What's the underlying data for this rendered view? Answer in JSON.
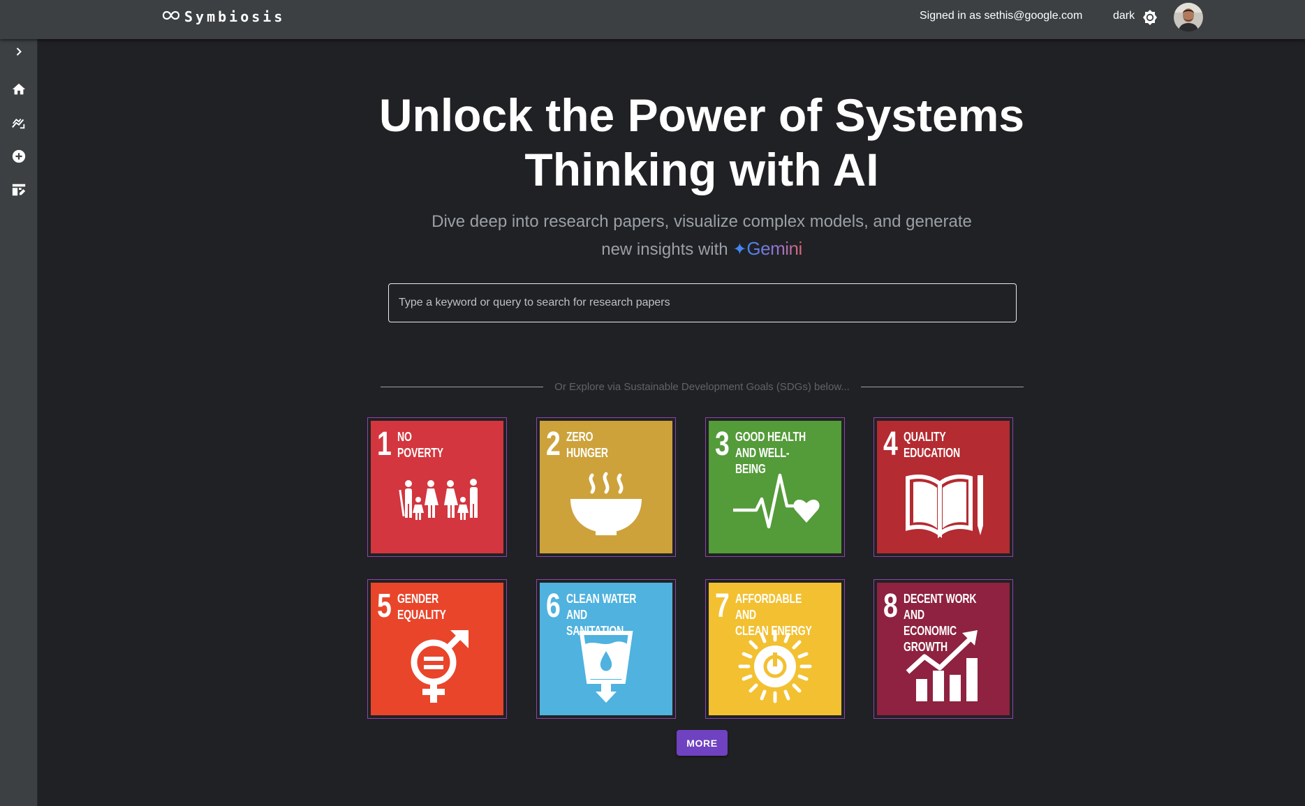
{
  "app": {
    "name": "Symbiosis"
  },
  "header": {
    "signed_in_text": "Signed in as sethis@google.com",
    "theme_label": "dark"
  },
  "sidebar": {
    "items": [
      {
        "icon": "chevron-right-icon"
      },
      {
        "icon": "home-icon"
      },
      {
        "icon": "analytics-icon"
      },
      {
        "icon": "add-circle-icon"
      },
      {
        "icon": "dashboard-edit-icon"
      }
    ]
  },
  "hero": {
    "title": "Unlock the Power of Systems Thinking with AI",
    "subtitle_prefix": "Dive deep into research papers, visualize complex models, and generate new insights with",
    "gemini_label": "Gemini"
  },
  "search": {
    "placeholder": "Type a keyword or query to search for research papers"
  },
  "divider_text": "Or Explore via Sustainable Development Goals (SDGs) below...",
  "sdgs": [
    {
      "number": "1",
      "title": "No\nPoverty",
      "color": "#d3363e",
      "icon": "family-icon"
    },
    {
      "number": "2",
      "title": "Zero\nHunger",
      "color": "#cda23b",
      "icon": "bowl-icon"
    },
    {
      "number": "3",
      "title": "Good Health\nand Well-Being",
      "color": "#549b3a",
      "icon": "heartbeat-icon"
    },
    {
      "number": "4",
      "title": "Quality\nEducation",
      "color": "#b42b31",
      "icon": "book-icon"
    },
    {
      "number": "5",
      "title": "Gender\nEquality",
      "color": "#e9452b",
      "icon": "gender-equality-icon"
    },
    {
      "number": "6",
      "title": "Clean Water\nand Sanitation",
      "color": "#4fb2df",
      "icon": "water-glass-icon"
    },
    {
      "number": "7",
      "title": "Affordable and\nClean Energy",
      "color": "#f2c031",
      "icon": "sun-power-icon"
    },
    {
      "number": "8",
      "title": "Decent Work and\nEconomic Growth",
      "color": "#8e2240",
      "icon": "growth-chart-icon"
    }
  ],
  "more_label": "MORE"
}
